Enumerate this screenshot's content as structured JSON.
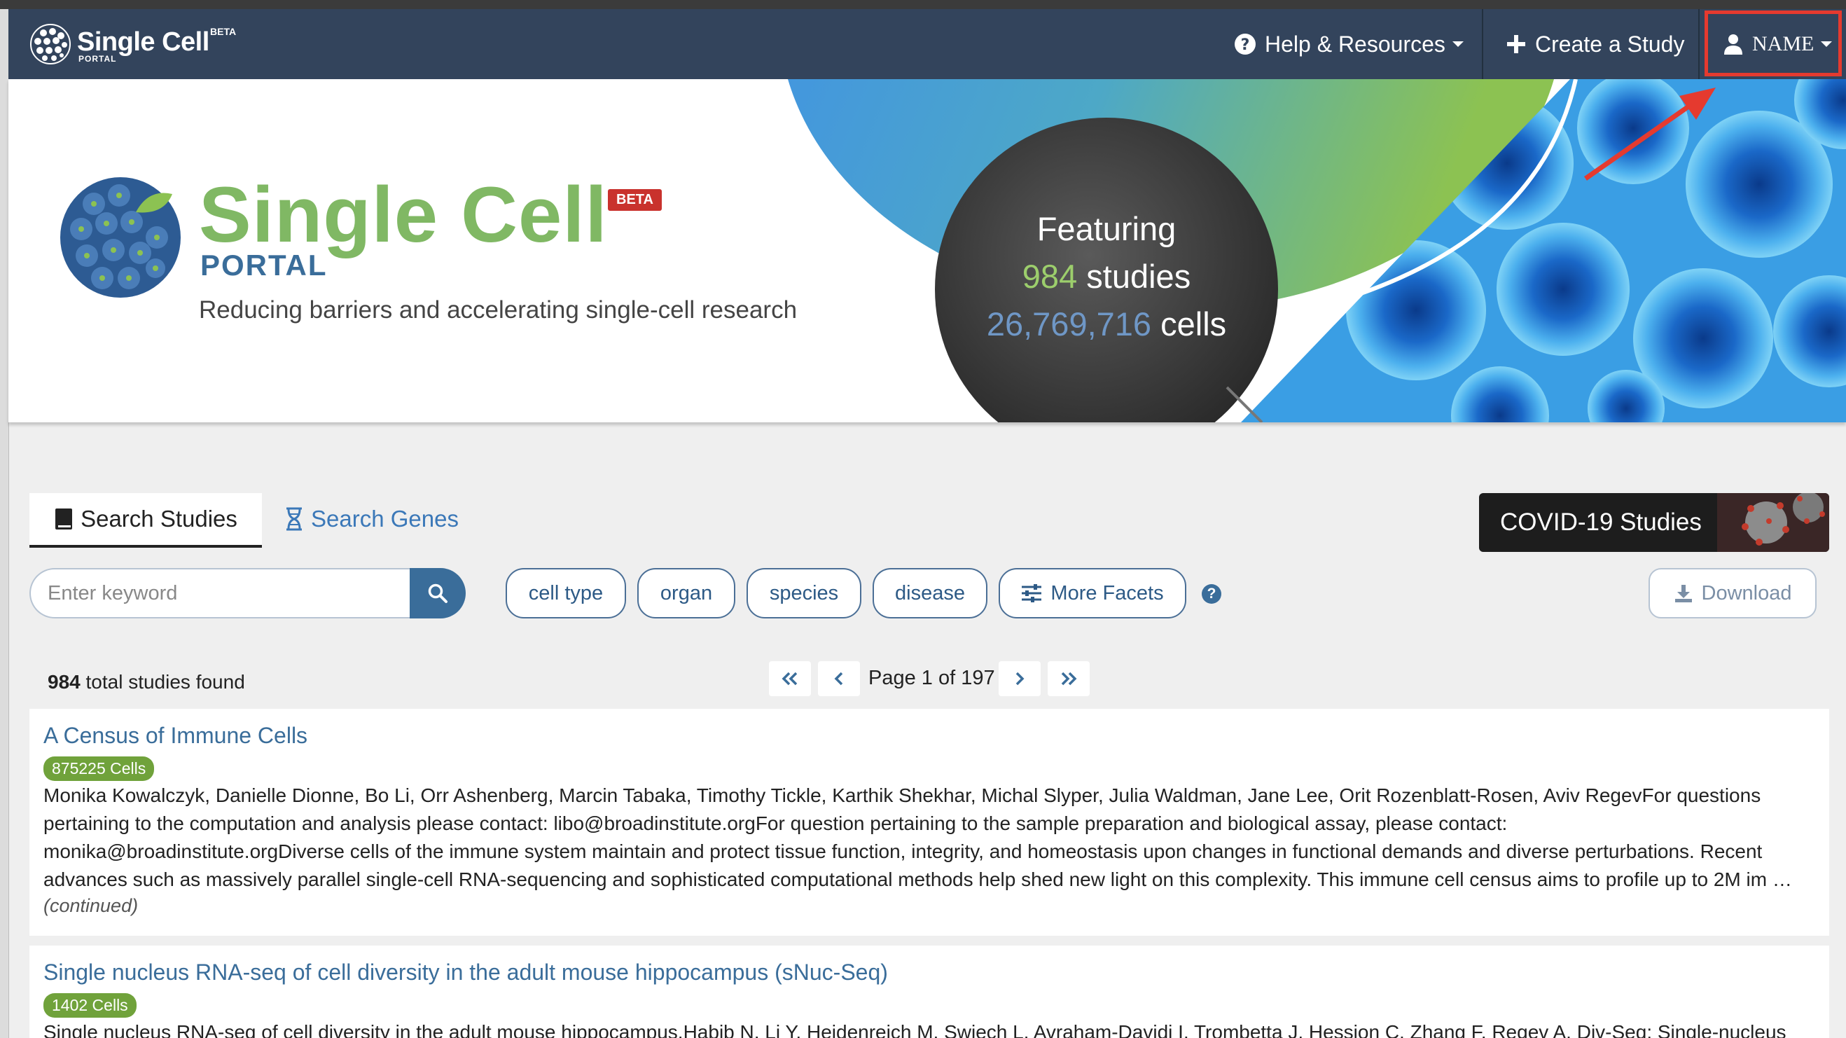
{
  "navbar": {
    "brand_title": "Single Cell",
    "brand_sub": "PORTAL",
    "brand_beta": "BETA",
    "help": "Help & Resources",
    "create": "Create a Study",
    "user": "NAME"
  },
  "hero": {
    "title": "Single Cell",
    "beta": "BETA",
    "portal": "PORTAL",
    "tagline": "Reducing barriers and accelerating single-cell research",
    "featuring": "Featuring",
    "studies_count": "984",
    "studies_label": "studies",
    "cells_count": "26,769,716",
    "cells_label": "cells"
  },
  "search": {
    "tab_studies": "Search Studies",
    "tab_genes": "Search Genes",
    "placeholder": "Enter keyword",
    "facets": [
      "cell type",
      "organ",
      "species",
      "disease",
      "More Facets"
    ],
    "covid": "COVID-19 Studies",
    "download": "Download"
  },
  "results": {
    "count": "984",
    "count_label": "total studies found",
    "page_label": "Page 1 of 197",
    "studies": [
      {
        "title": "A Census of Immune Cells",
        "cells": "875225 Cells",
        "description": "Monika Kowalczyk, Danielle Dionne, Bo Li, Orr Ashenberg, Marcin Tabaka, Timothy Tickle, Karthik Shekhar, Michal Slyper, Julia Waldman, Jane Lee, Orit Rozenblatt-Rosen, Aviv RegevFor questions pertaining to the computation and analysis please contact: libo@broadinstitute.orgFor question pertaining to the sample preparation and biological assay, please contact: monika@broadinstitute.orgDiverse cells of the immune system maintain and protect tissue function, integrity, and homeostasis upon changes in functional demands and diverse perturbations. Recent advances such as massively parallel single-cell RNA-sequencing and sophisticated computational methods help shed new light on this complexity. This immune cell census aims to profile up to 2M im …",
        "continued": "(continued)"
      },
      {
        "title": "Single nucleus RNA-seq of cell diversity in the adult mouse hippocampus (sNuc-Seq)",
        "cells": "1402 Cells",
        "description": "Single nucleus RNA-seq of cell diversity in the adult mouse hippocampus.Habib N, Li Y, Heidenreich M, Swiech L, Avraham-Davidi I, Trombetta J, Hession C, Zhang F, Regev A. Div-Seq: Single-nucleus"
      }
    ]
  },
  "colors": {
    "navbar": "#33445c",
    "brand_green": "#80b864",
    "brand_blue": "#3a6d9a",
    "highlight_red": "#e53a2f",
    "badge_green": "#70a23b"
  },
  "icons": [
    "question-circle-icon",
    "plus-icon",
    "user-icon",
    "book-icon",
    "hourglass-icon",
    "search-icon",
    "sliders-icon",
    "download-icon",
    "double-left-icon",
    "left-icon",
    "right-icon",
    "double-right-icon"
  ]
}
